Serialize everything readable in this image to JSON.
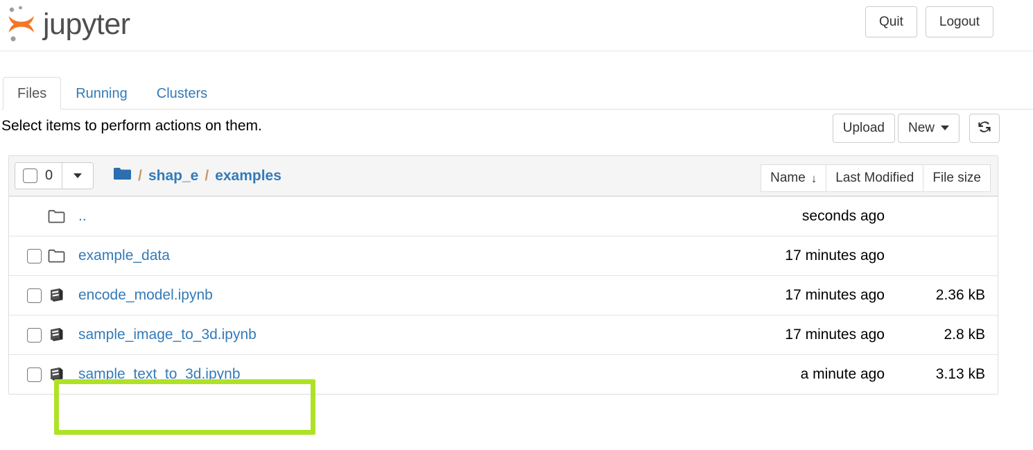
{
  "brand": {
    "name": "jupyter",
    "logo_icon": "jupyter-logo-icon",
    "logo_color": "#f37726",
    "dot_color": "#9e9e9e"
  },
  "header": {
    "quit_label": "Quit",
    "logout_label": "Logout"
  },
  "tabs": [
    {
      "label": "Files",
      "active": true
    },
    {
      "label": "Running",
      "active": false
    },
    {
      "label": "Clusters",
      "active": false
    }
  ],
  "toolbar": {
    "message": "Select items to perform actions on them.",
    "upload_label": "Upload",
    "new_label": "New",
    "new_caret_icon": "chevron-down-icon",
    "refresh_icon": "refresh-icon"
  },
  "list_header": {
    "select_all_checkbox": "checkbox-icon",
    "selected_count": "0",
    "dropdown_caret_icon": "chevron-down-icon",
    "breadcrumb": {
      "home_icon": "folder-filled-icon",
      "separator": "/",
      "items": [
        {
          "label": "shap_e"
        },
        {
          "label": "examples"
        }
      ]
    },
    "sort_buttons": [
      {
        "label": "Name",
        "arrow": "↓",
        "sorted": true
      },
      {
        "label": "Last Modified",
        "arrow": "",
        "sorted": false
      },
      {
        "label": "File size",
        "arrow": "",
        "sorted": false
      }
    ]
  },
  "files": [
    {
      "name": "..",
      "icon": "folder-outline-icon",
      "type": "parent-directory",
      "has_checkbox": false,
      "modified": "seconds ago",
      "size": ""
    },
    {
      "name": "example_data",
      "icon": "folder-outline-icon",
      "type": "directory",
      "has_checkbox": true,
      "modified": "17 minutes ago",
      "size": ""
    },
    {
      "name": "encode_model.ipynb",
      "icon": "notebook-icon",
      "type": "notebook",
      "has_checkbox": true,
      "modified": "17 minutes ago",
      "size": "2.36 kB"
    },
    {
      "name": "sample_image_to_3d.ipynb",
      "icon": "notebook-icon",
      "type": "notebook",
      "has_checkbox": true,
      "modified": "17 minutes ago",
      "size": "2.8 kB"
    },
    {
      "name": "sample_text_to_3d.ipynb",
      "icon": "notebook-icon",
      "type": "notebook",
      "has_checkbox": true,
      "modified": "a minute ago",
      "size": "3.13 kB"
    }
  ],
  "annotation": {
    "target": "sample_text_to_3d.ipynb",
    "color": "#aee227"
  },
  "colors": {
    "link": "#337ab7",
    "brand_orange": "#f37726",
    "folder_blue": "#2c6eaf",
    "header_bg": "#f5f5f5",
    "border": "#dddddd"
  }
}
